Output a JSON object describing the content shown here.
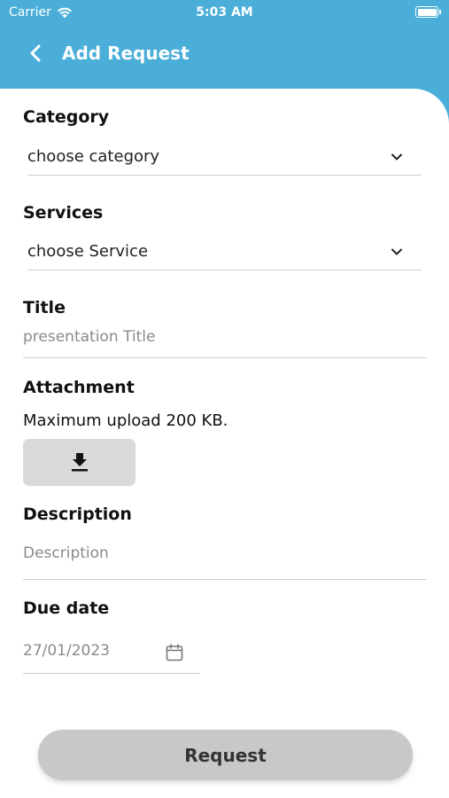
{
  "status_bar": {
    "carrier": "Carrier",
    "time": "5:03 AM"
  },
  "header": {
    "title": "Add Request",
    "back_icon": "chevron-left-icon"
  },
  "form": {
    "category": {
      "label": "Category",
      "value": "choose category"
    },
    "services": {
      "label": "Services",
      "value": "choose Service"
    },
    "title": {
      "label": "Title",
      "placeholder": "presentation Title"
    },
    "attachment": {
      "label": "Attachment",
      "helper": "Maximum upload 200 KB.",
      "icon": "download-icon"
    },
    "description": {
      "label": "Description",
      "placeholder": "Description"
    },
    "due_date": {
      "label": "Due date",
      "value": "27/01/2023",
      "icon": "calendar-icon"
    }
  },
  "submit": {
    "label": "Request"
  },
  "colors": {
    "brand": "#4aaed9",
    "card": "#ffffff",
    "button": "#c8c8c8",
    "divider": "#cfcfcf"
  }
}
